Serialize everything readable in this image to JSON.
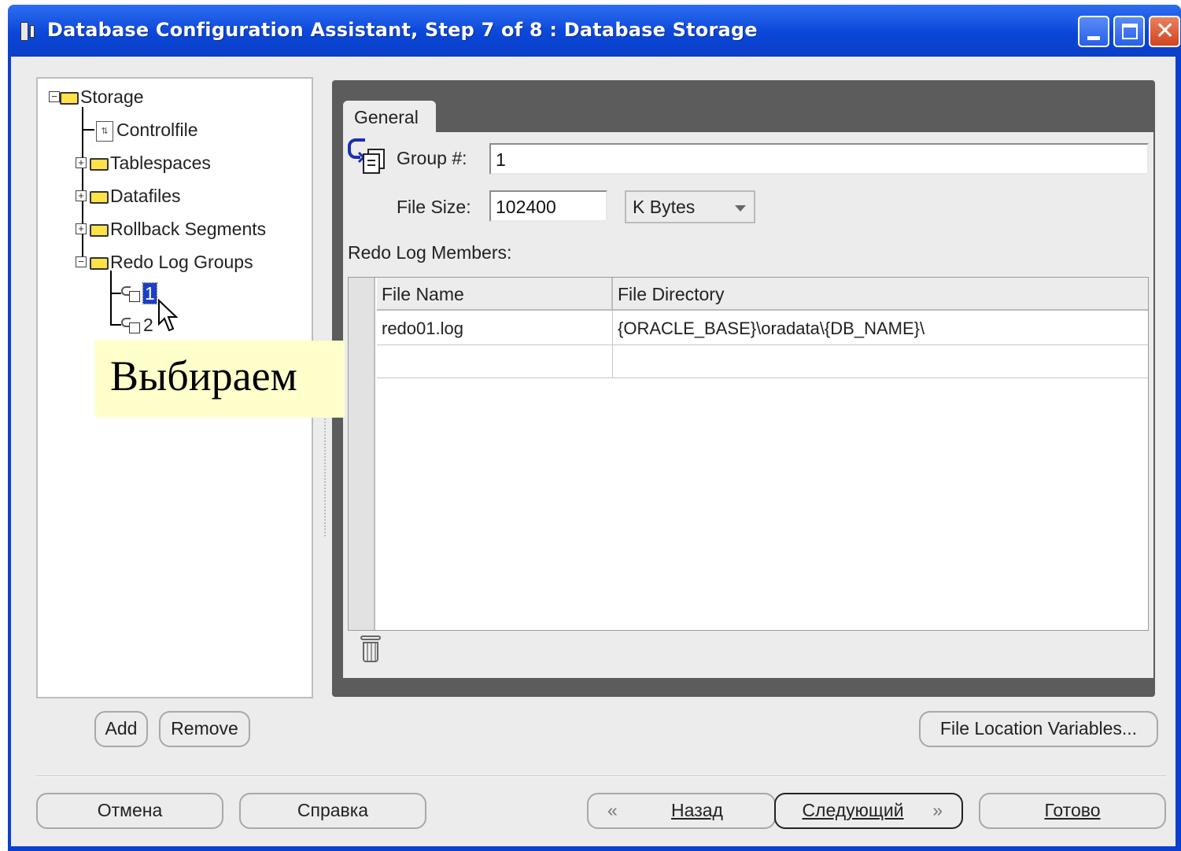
{
  "window": {
    "title": "Database Configuration Assistant, Step 7 of 8 : Database Storage"
  },
  "tree": {
    "root": "Storage",
    "items": [
      {
        "label": "Controlfile"
      },
      {
        "label": "Tablespaces"
      },
      {
        "label": "Datafiles"
      },
      {
        "label": "Rollback Segments"
      },
      {
        "label": "Redo Log Groups"
      }
    ],
    "redo_groups": [
      "1",
      "2"
    ]
  },
  "callout": "Выбираем",
  "tab": {
    "label": "General"
  },
  "form": {
    "group_label": "Group #:",
    "group_value": "1",
    "file_size_label": "File Size:",
    "file_size_value": "102400",
    "unit": "K Bytes",
    "members_label": "Redo Log Members:"
  },
  "table": {
    "columns": [
      "File Name",
      "File Directory"
    ],
    "rows": [
      [
        "redo01.log",
        "{ORACLE_BASE}\\oradata\\{DB_NAME}\\"
      ],
      [
        "",
        ""
      ]
    ]
  },
  "buttons": {
    "add": "Add",
    "remove": "Remove",
    "file_location": "File Location Variables...",
    "cancel": "Отмена",
    "help": "Справка",
    "back": "Назад",
    "next": "Следующий",
    "finish": "Готово"
  }
}
